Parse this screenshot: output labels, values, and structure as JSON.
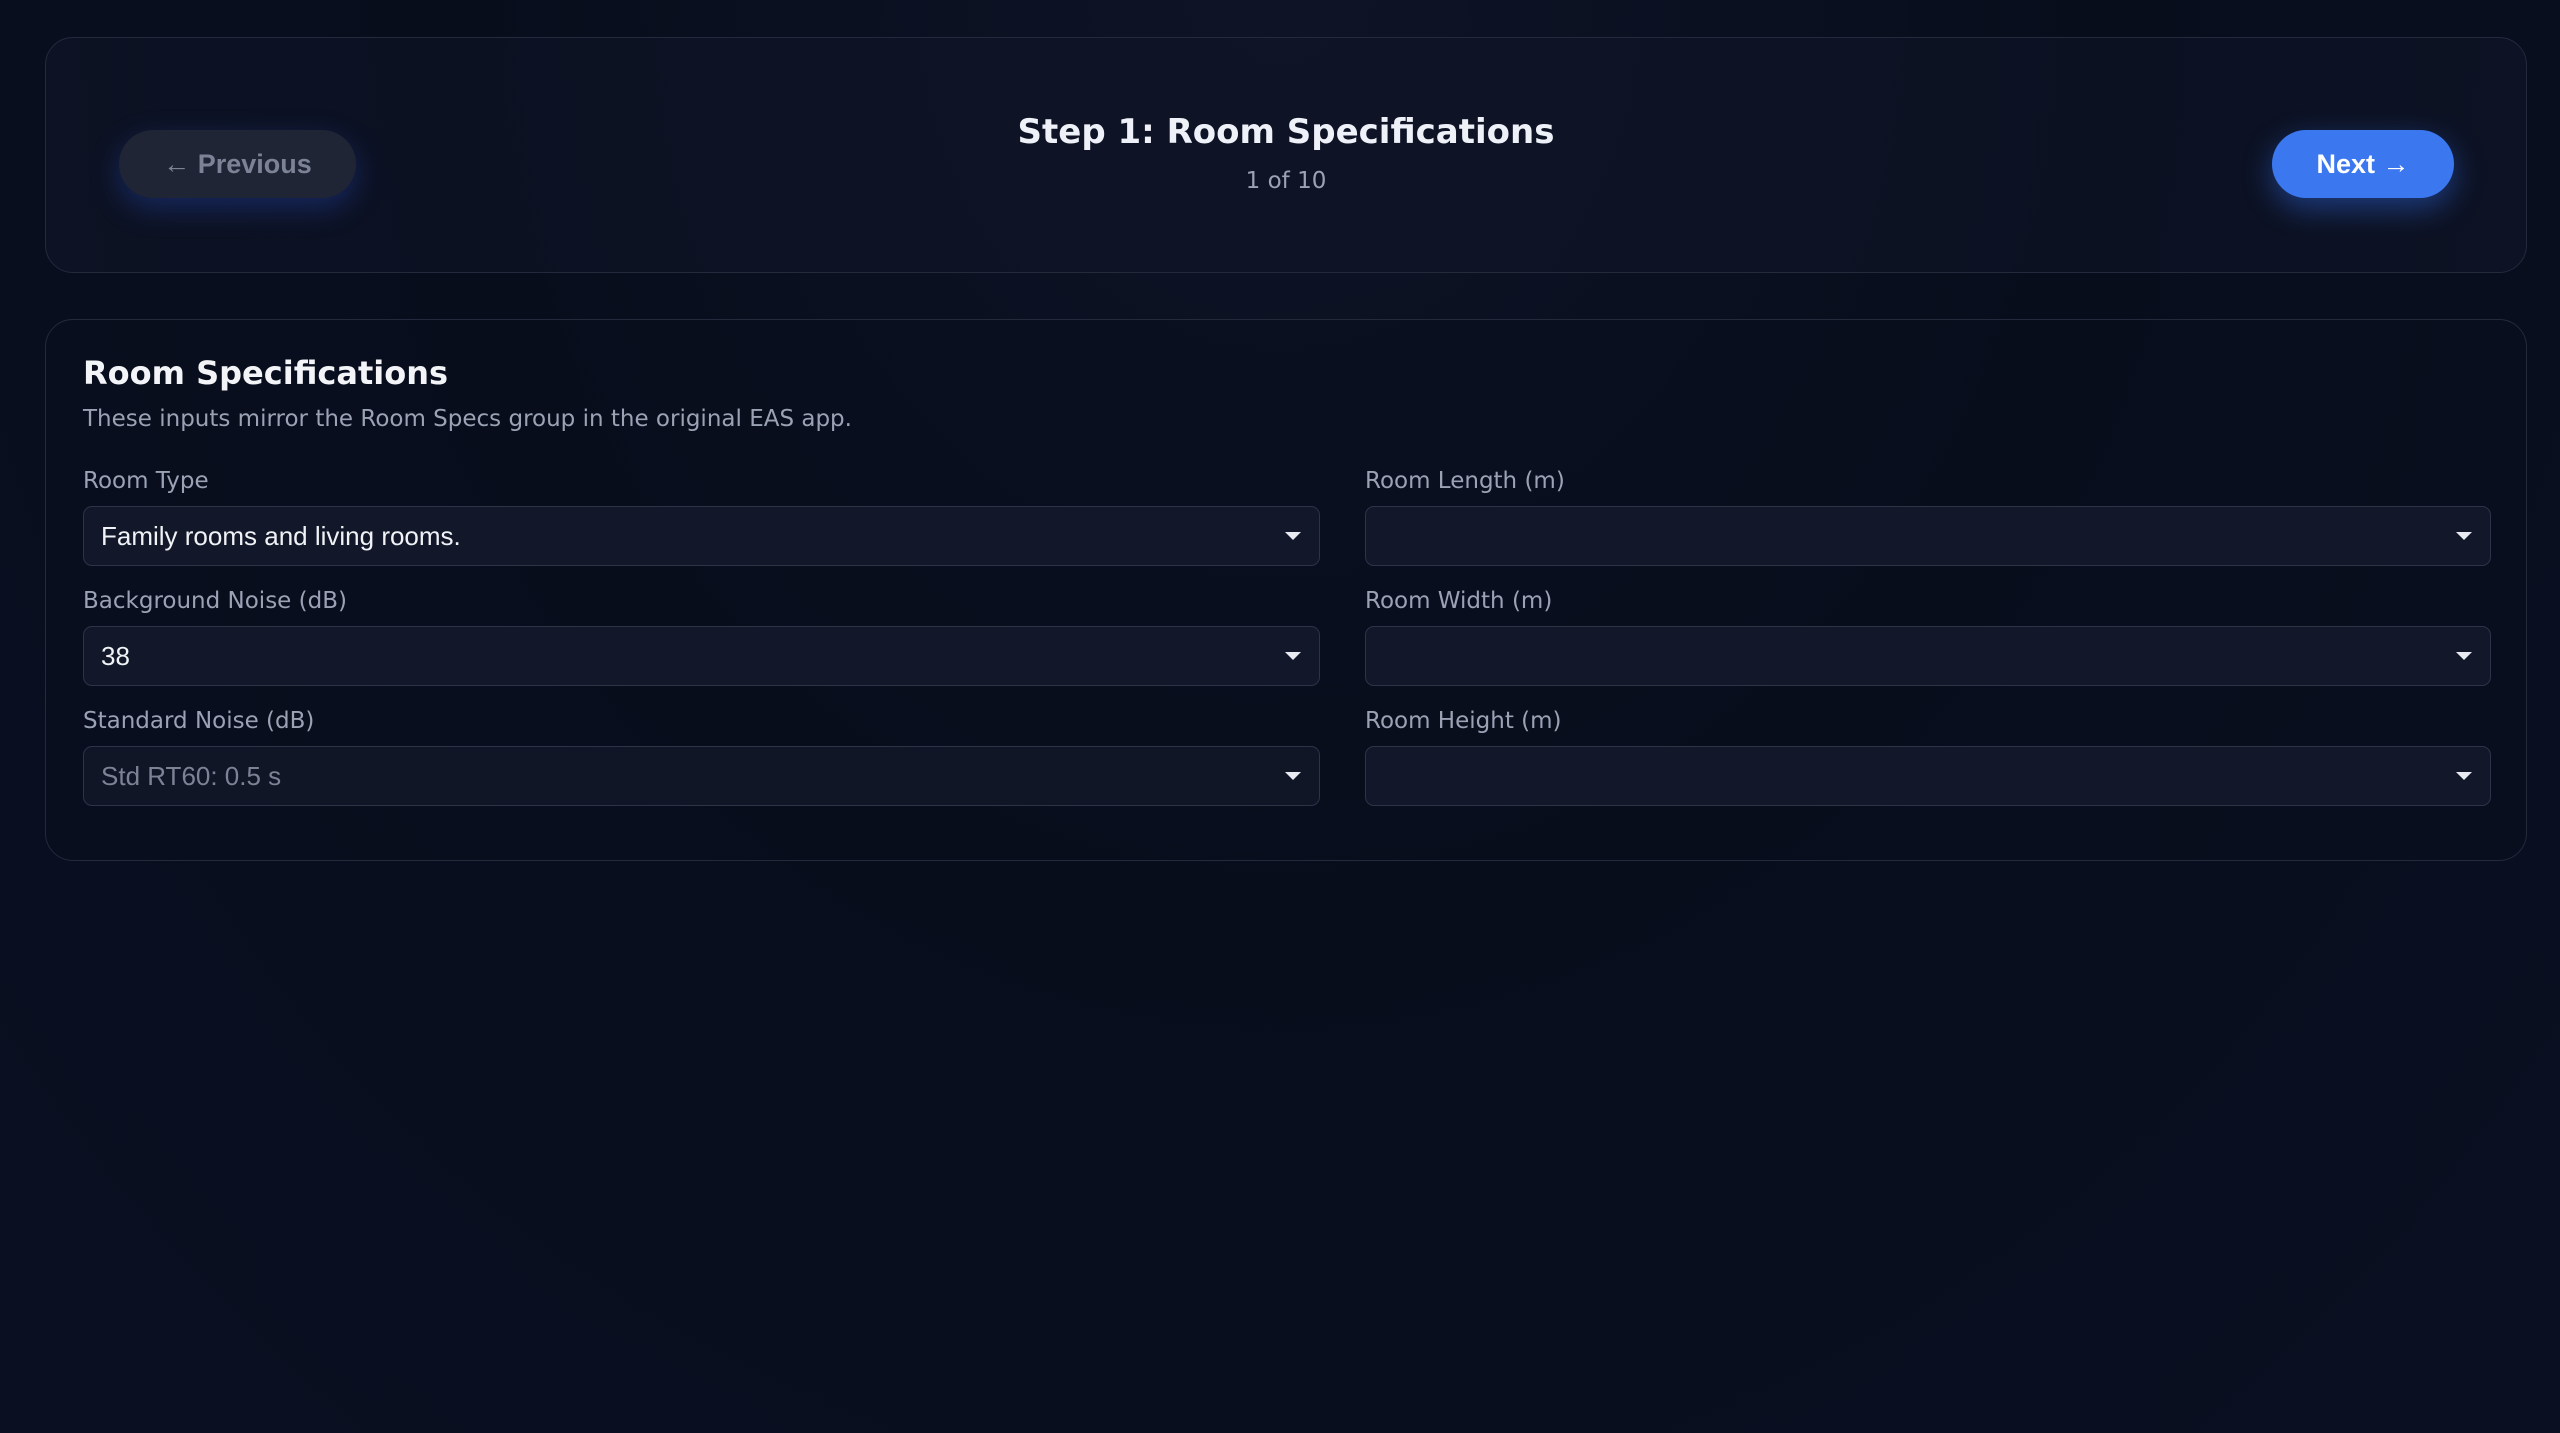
{
  "nav": {
    "previous_label": "← Previous",
    "next_label": "Next →",
    "step_title": "Step 1: Room Specifications",
    "step_counter": "1 of 10"
  },
  "section": {
    "title": "Room Specifications",
    "description": "These inputs mirror the Room Specs group in the original EAS app."
  },
  "fields": {
    "room_type": {
      "label": "Room Type",
      "value": "Family rooms and living rooms."
    },
    "background_noise": {
      "label": "Background Noise (dB)",
      "value": "38"
    },
    "standard_noise": {
      "label": "Standard Noise (dB)",
      "value": "Std RT60: 0.5 s",
      "disabled": true
    },
    "room_length": {
      "label": "Room Length (m)",
      "value": ""
    },
    "room_width": {
      "label": "Room Width (m)",
      "value": ""
    },
    "room_height": {
      "label": "Room Height (m)",
      "value": ""
    }
  },
  "icons": {
    "dropdown": "chevron-down-icon"
  },
  "colors": {
    "accent": "#3b78f0",
    "background": "#080d1c",
    "muted_text": "#9aa2b4"
  }
}
